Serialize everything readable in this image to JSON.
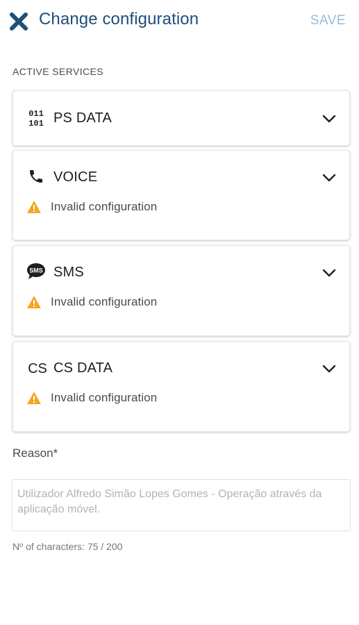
{
  "header": {
    "close_icon": "close-x-icon",
    "title": "Change configuration",
    "save_label": "SAVE",
    "title_color": "#1f4e79",
    "save_color": "#9bbbd3"
  },
  "section_label": "ACTIVE SERVICES",
  "services": [
    {
      "icon": "binary-data-icon",
      "icon_text_top": "011",
      "icon_text_bottom": "101",
      "label": "PS DATA",
      "warning": null
    },
    {
      "icon": "phone-icon",
      "label": "VOICE",
      "warning": "Invalid configuration"
    },
    {
      "icon": "sms-bubble-icon",
      "icon_text": "SMS",
      "label": "SMS",
      "warning": "Invalid configuration"
    },
    {
      "icon": "cs-text-icon",
      "icon_text": "CS",
      "label": "CS DATA",
      "warning": "Invalid configuration"
    }
  ],
  "warning_color": "#f5a623",
  "reason": {
    "label": "Reason*",
    "placeholder": "Utilizador Alfredo Simão Lopes Gomes - Operação através da aplicação móvel.",
    "value": ""
  },
  "char_count": "Nº of characters: 75 / 200"
}
